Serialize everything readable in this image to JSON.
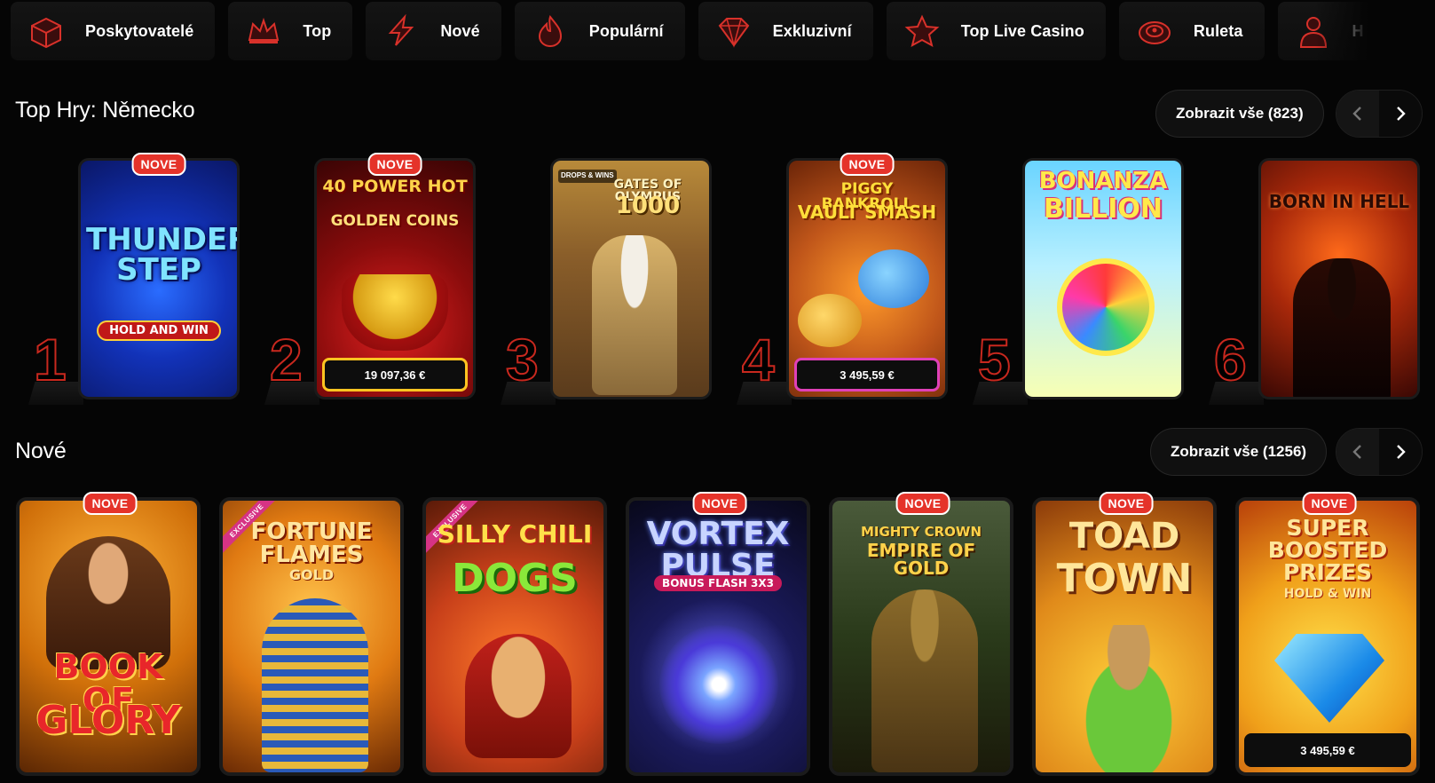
{
  "nav": {
    "categories": [
      {
        "label": "Poskytovatelé",
        "icon": "providers-box-icon"
      },
      {
        "label": "Top",
        "icon": "top-crown-icon"
      },
      {
        "label": "Nové",
        "icon": "new-lightning-icon"
      },
      {
        "label": "Populární",
        "icon": "popular-fire-icon"
      },
      {
        "label": "Exkluzivní",
        "icon": "exclusive-gem-icon"
      },
      {
        "label": "Top Live Casino",
        "icon": "live-casino-star-icon"
      },
      {
        "label": "Ruleta",
        "icon": "roulette-wheel-icon"
      },
      {
        "label": "H",
        "icon": "dealer-person-icon"
      }
    ]
  },
  "top_section": {
    "title": "Top Hry: Německo",
    "view_all": "Zobrazit vše (823)",
    "games": [
      {
        "rank": "1",
        "title": "Thunder Step",
        "subtitle": "Hold and Win",
        "badge": "NOVE",
        "jackpot": ""
      },
      {
        "rank": "2",
        "title": "40 Power Hot",
        "subtitle": "Golden Coins",
        "badge": "NOVE",
        "jackpot": "19 097,36 €"
      },
      {
        "rank": "3",
        "title": "Gates of Olympus",
        "subtitle": "1000",
        "badge": "",
        "jackpot": "",
        "tag": "DROPS & WINS"
      },
      {
        "rank": "4",
        "title": "Piggy Bankroll",
        "subtitle": "Vault Smash",
        "badge": "NOVE",
        "jackpot": "3 495,59 €"
      },
      {
        "rank": "5",
        "title": "Bonanza",
        "subtitle": "Billion",
        "badge": "",
        "jackpot": ""
      },
      {
        "rank": "6",
        "title": "Born in Hell",
        "subtitle": "",
        "badge": "",
        "jackpot": ""
      }
    ]
  },
  "new_section": {
    "title": "Nové",
    "view_all": "Zobrazit vše (1256)",
    "games": [
      {
        "title": "Book of",
        "subtitle": "Glory",
        "badge": "NOVE",
        "ribbon": "",
        "jackpot": ""
      },
      {
        "title": "Fortune Flames",
        "subtitle": "Gold",
        "badge": "",
        "ribbon": "EXCLUSIVE",
        "jackpot": ""
      },
      {
        "title": "Silly Chili",
        "subtitle": "Dogs",
        "badge": "",
        "ribbon": "EXCLUSIVE",
        "jackpot": ""
      },
      {
        "title": "Vortex Pulse",
        "subtitle": "Bonus Flash 3x3",
        "badge": "NOVE",
        "ribbon": "",
        "jackpot": ""
      },
      {
        "title": "Mighty Crown",
        "subtitle": "Empire of Gold",
        "badge": "NOVE",
        "ribbon": "",
        "jackpot": ""
      },
      {
        "title": "Toad",
        "subtitle": "Town",
        "badge": "NOVE",
        "ribbon": "",
        "jackpot": ""
      },
      {
        "title": "Super Boosted Prizes",
        "subtitle": "Hold & Win",
        "badge": "NOVE",
        "ribbon": "",
        "jackpot": "3 495,59 €"
      }
    ]
  },
  "colors": {
    "accent_red": "#e5332a",
    "background": "#050505",
    "card_border": "#1b1b1b"
  }
}
